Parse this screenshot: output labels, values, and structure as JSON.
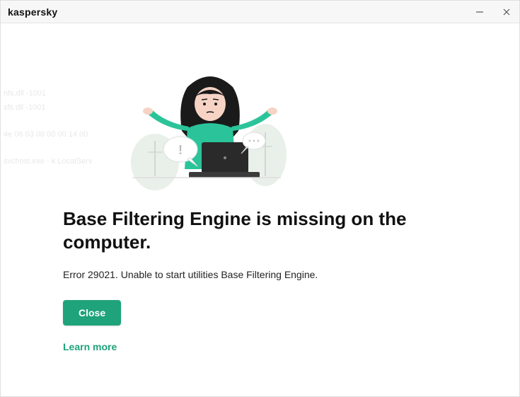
{
  "titlebar": {
    "logo": "kaspersky"
  },
  "ghost_text": {
    "line1": "nfs.dll -1001",
    "line2": "sfs.dll -1001",
    "line3": "4e 06 03 00 00 00 14 00",
    "line4": "svchost.exe - k LocalServ"
  },
  "dialog": {
    "heading": "Base Filtering Engine is missing on the computer.",
    "body": "Error 29021. Unable to start utilities Base Filtering Engine.",
    "close_label": "Close",
    "learn_more_label": "Learn more"
  },
  "colors": {
    "accent": "#1fa37a"
  }
}
